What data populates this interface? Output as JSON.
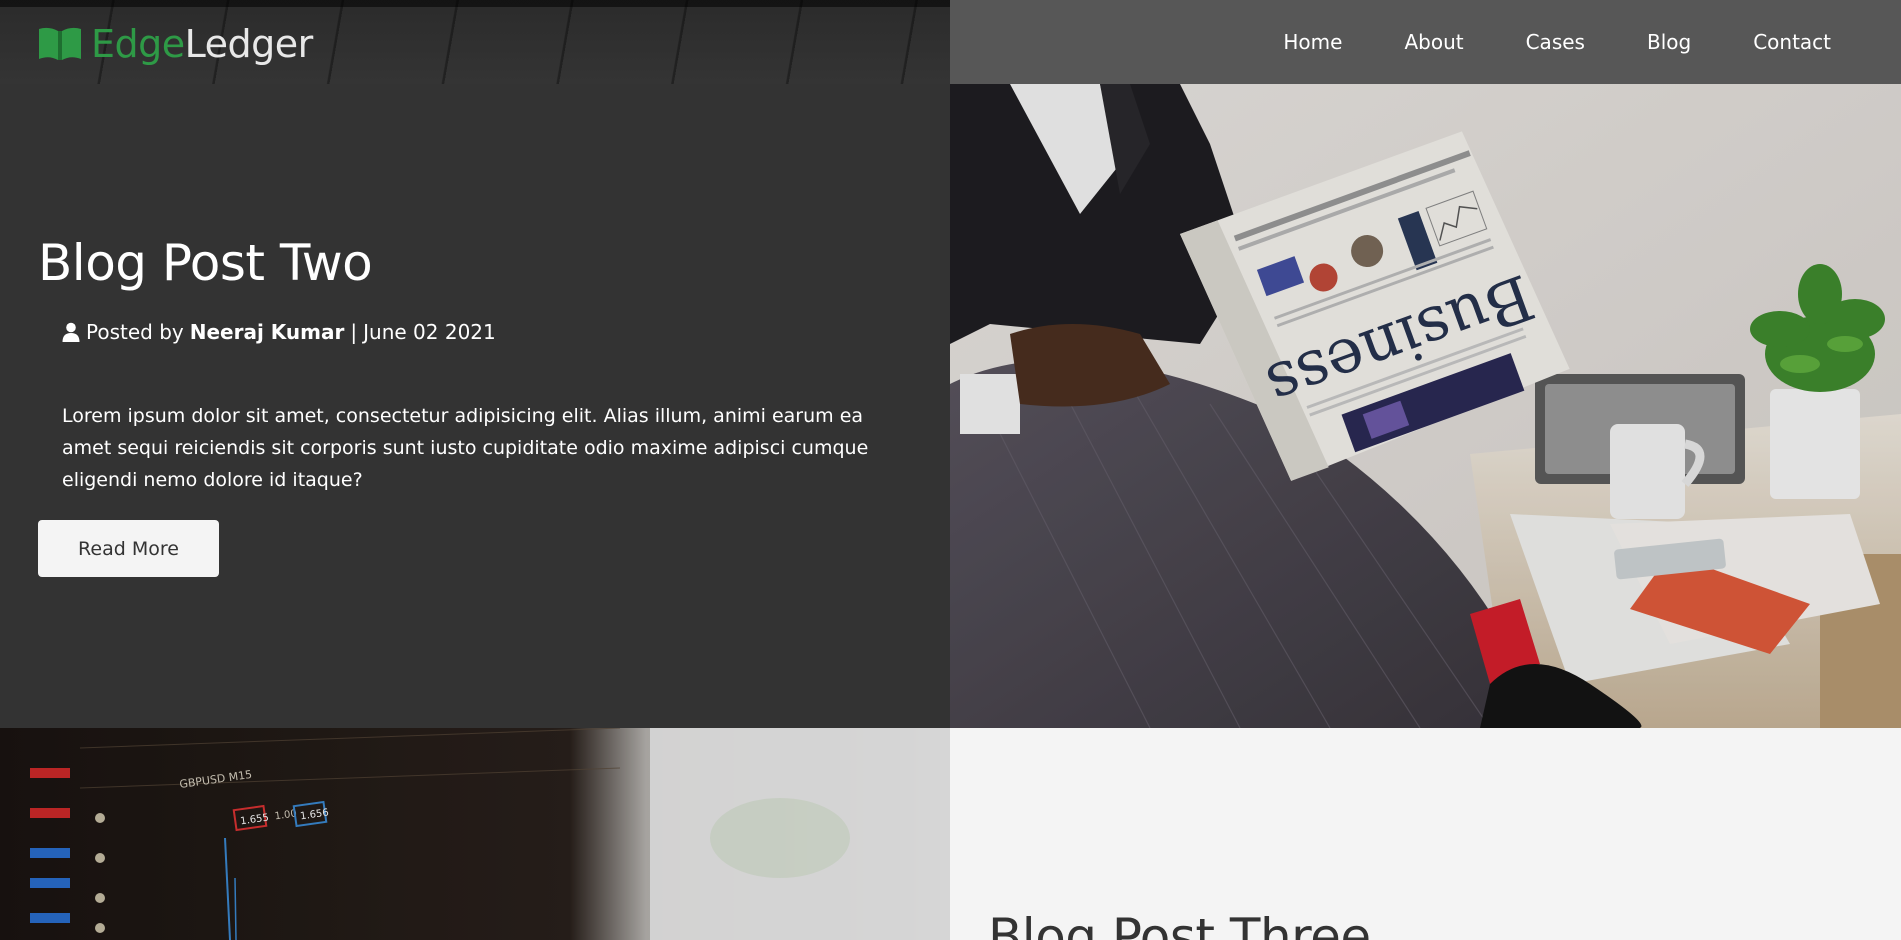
{
  "header": {
    "brand": {
      "part1": "Edge",
      "part2": "Ledger",
      "icon": "open-book-icon",
      "accent_color": "#2e9a46"
    },
    "nav": [
      "Home",
      "About",
      "Cases",
      "Blog",
      "Contact"
    ]
  },
  "post_two": {
    "title": "Blog Post Two",
    "meta": {
      "icon": "user-icon",
      "posted_by": "Posted by",
      "author": "Neeraj Kumar",
      "separator": "|",
      "date": "June 02 2021"
    },
    "excerpt": "Lorem ipsum dolor sit amet, consectetur adipisicing elit. Alias illum, animi earum ea amet sequi reiciendis sit corporis sunt iusto cupiditate odio maxime adipisci cumque eligendi nemo dolore id itaque?",
    "button": "Read More",
    "image": {
      "newspaper_headline": "Business"
    }
  },
  "post_three": {
    "title": "Blog Post Three",
    "image": {
      "ticker_labels": [
        "GBPUSD M15",
        "1.655",
        "1.00",
        "1.656"
      ]
    }
  }
}
